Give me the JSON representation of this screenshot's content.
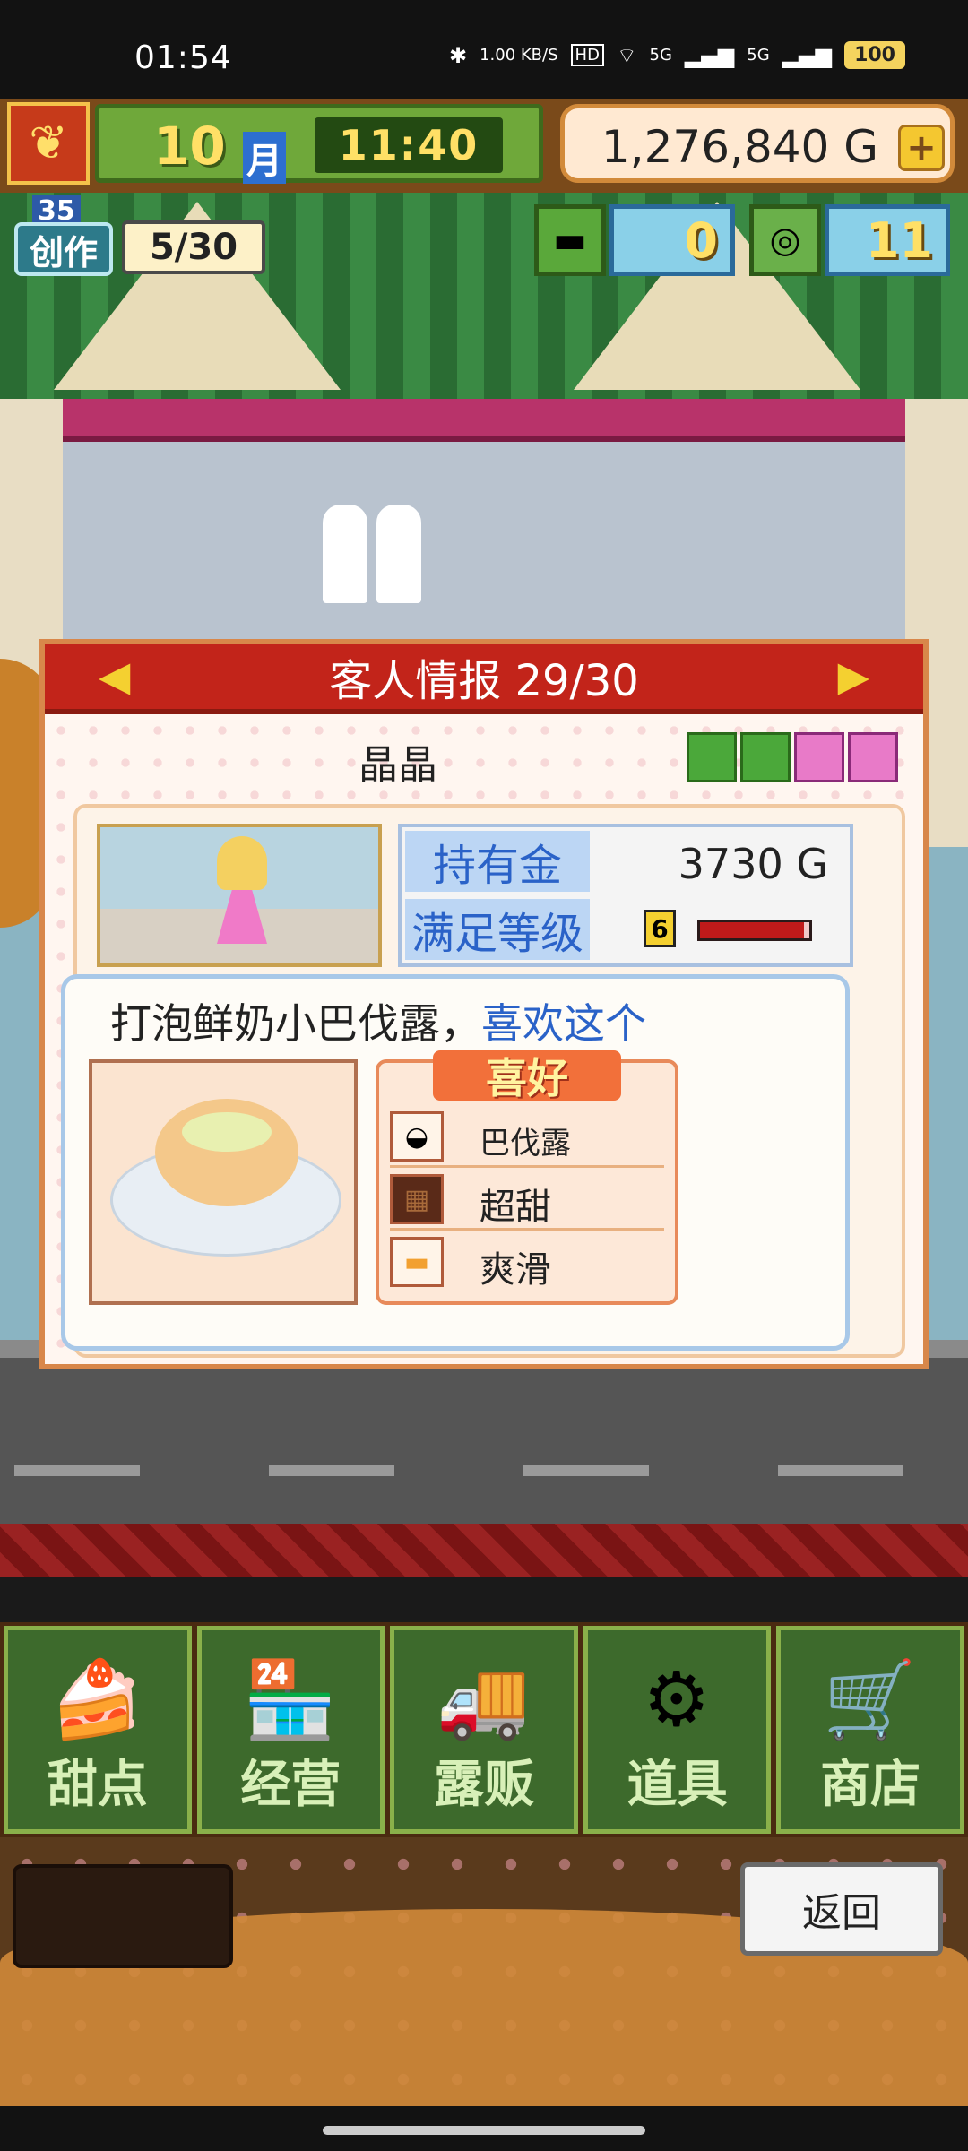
{
  "statusbar": {
    "time": "01:54",
    "net_speed": "1.00 KB/S",
    "hd": "HD",
    "signal1": "5G",
    "signal2": "5G",
    "battery": "100"
  },
  "hud": {
    "month_num": "10",
    "month_label": "月",
    "clock": "11:40",
    "money": "1,276,840 G",
    "plus": "+"
  },
  "badge": {
    "level": "35",
    "craft_label": "创作",
    "progress": "5/30"
  },
  "tickets": {
    "gold_ticket_count": "0",
    "silver_medal_count": "11"
  },
  "panel": {
    "title": "客人情报 29/30",
    "customer_name": "晶晶",
    "gifts": 4,
    "gold_label": "持有金",
    "gold_value": "3730 G",
    "satisfaction_label": "满足等级",
    "satisfaction_level": "6",
    "satisfaction_fill": 0.95,
    "quote_dish": "打泡鲜奶小巴伐露，",
    "quote_like": "喜欢这个",
    "prefs_header": "喜好",
    "prefs": [
      "巴伐露",
      "超甜",
      "爽滑"
    ]
  },
  "menu": [
    {
      "label": "甜点",
      "icon": "cake-icon"
    },
    {
      "label": "经营",
      "icon": "shop-icon"
    },
    {
      "label": "露贩",
      "icon": "food-truck-icon"
    },
    {
      "label": "道具",
      "icon": "items-icon"
    },
    {
      "label": "商店",
      "icon": "cart-icon"
    }
  ],
  "back_button": "返回",
  "colors": {
    "title_red": "#c2241a",
    "label_blue": "#2a62c8",
    "menu_green": "#3d6a2c"
  }
}
